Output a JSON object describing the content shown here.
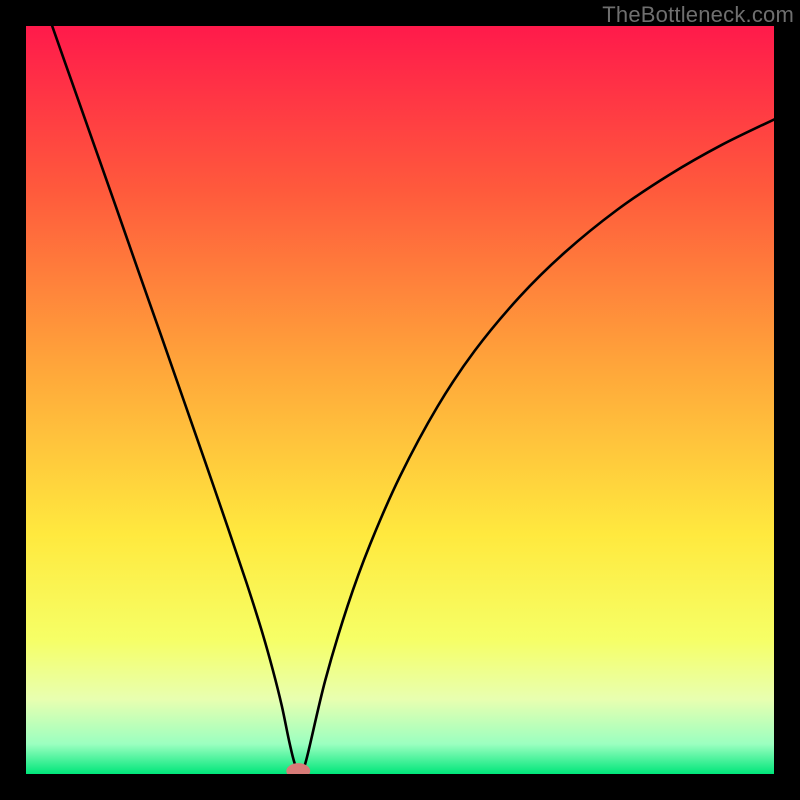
{
  "attribution": "TheBottleneck.com",
  "chart_data": {
    "type": "line",
    "title": "",
    "xlabel": "",
    "ylabel": "",
    "xlim": [
      0,
      100
    ],
    "ylim": [
      0,
      100
    ],
    "gradient_stops": [
      {
        "offset": 0,
        "color": "#ff1a4b"
      },
      {
        "offset": 0.22,
        "color": "#ff5a3c"
      },
      {
        "offset": 0.45,
        "color": "#ffa43a"
      },
      {
        "offset": 0.68,
        "color": "#ffe93e"
      },
      {
        "offset": 0.82,
        "color": "#f6ff66"
      },
      {
        "offset": 0.9,
        "color": "#e8ffb0"
      },
      {
        "offset": 0.96,
        "color": "#9bffc0"
      },
      {
        "offset": 1.0,
        "color": "#00e67a"
      }
    ],
    "series": [
      {
        "name": "curve",
        "color": "#000000",
        "x": [
          3.5,
          6,
          9,
          12,
          15,
          18,
          21,
          24,
          27,
          29.5,
          31.5,
          33,
          34.2,
          35.2,
          36,
          36.8,
          37.5,
          40,
          43,
          46,
          50,
          55,
          60,
          66,
          72,
          79,
          86,
          93,
          100
        ],
        "y": [
          100,
          92.9,
          84.4,
          75.9,
          67.3,
          58.8,
          50.2,
          41.6,
          32.9,
          25.5,
          19.2,
          13.9,
          9.1,
          4.3,
          1.2,
          0.5,
          2.0,
          12.5,
          22.5,
          30.7,
          39.8,
          49.1,
          56.6,
          63.8,
          69.7,
          75.4,
          80.1,
          84.1,
          87.5
        ]
      }
    ],
    "marker": {
      "x": 36.4,
      "y": 0.4,
      "rx": 1.6,
      "ry": 1.05,
      "color": "#d87b78"
    }
  }
}
